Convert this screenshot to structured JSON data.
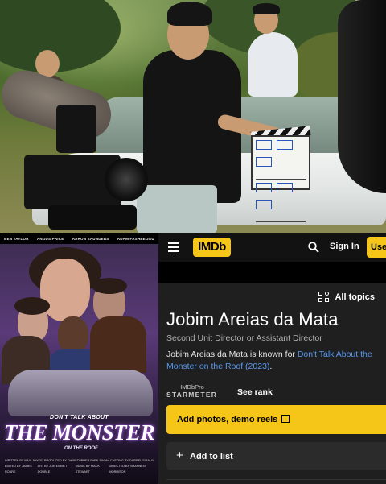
{
  "poster": {
    "cast": [
      "BEN TAYLOR",
      "ANGUS PRICE",
      "AARON SAUNDERS",
      "ADAM FASHBEGGU"
    ],
    "tagline": "DON'T TALK ABOUT",
    "title": "THE MONSTER",
    "subtitle": "ON THE ROOF",
    "credits": [
      [
        "WRITTEN BY NAIA JOYCE",
        "PRODUCED BY CHRISTOPHER PARK SWAN",
        "CASTING BY DARREL SIRALIN"
      ],
      [
        "EDITED BY JAMES ROARE",
        "ART BY JOE EMMETT DOUBLE",
        "MUSIC BY MACK STEWART",
        "DIRECTED BY SHANNEN MORRISON"
      ]
    ]
  },
  "imdb": {
    "logo": "IMDb",
    "sign_in": "Sign In",
    "use_app": "Use",
    "all_topics": "All topics",
    "name": "Jobim Areias da Mata",
    "role": "Second Unit Director or Assistant Director",
    "known_prefix": "Jobim Areias da Mata is known for ",
    "known_link": "Don't Talk About the Monster on the Roof (2023)",
    "known_suffix": ".",
    "starmeter_pro": "IMDbPro",
    "starmeter_label": "STARMETER",
    "see_rank": "See rank",
    "add_photos": "Add photos, demo reels",
    "add_to_list": "Add to list"
  },
  "colors": {
    "imdb_yellow": "#f5c518",
    "link_blue": "#5799ef",
    "panel_bg": "#1f1f1f"
  }
}
